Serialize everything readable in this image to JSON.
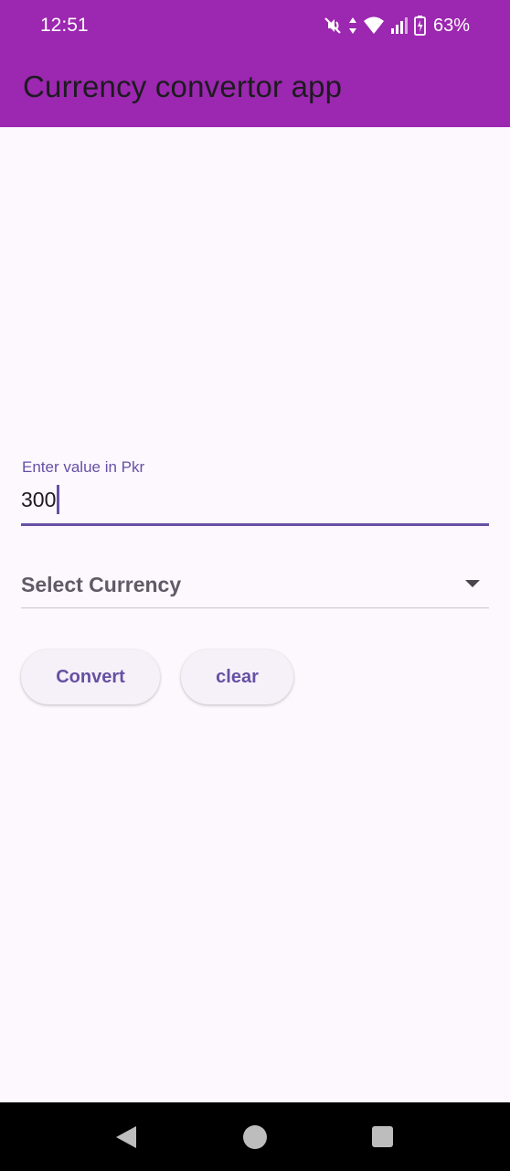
{
  "status_bar": {
    "time": "12:51",
    "battery_percent": "63%",
    "icons": [
      "mute-icon",
      "data-arrows-icon",
      "wifi-icon",
      "signal-icon",
      "battery-icon"
    ]
  },
  "app_bar": {
    "title": "Currency convertor app",
    "color": "#9c27b0"
  },
  "form": {
    "value_label": "Enter value in Pkr",
    "value": "300",
    "currency_hint": "Select Currency"
  },
  "buttons": {
    "convert_label": "Convert",
    "clear_label": "clear"
  },
  "colors": {
    "primary": "#6750a4",
    "background": "#fdf7fe",
    "app_bar": "#9c27b0"
  },
  "nav_bar": {
    "icons": [
      "back-icon",
      "home-icon",
      "recents-icon"
    ]
  }
}
